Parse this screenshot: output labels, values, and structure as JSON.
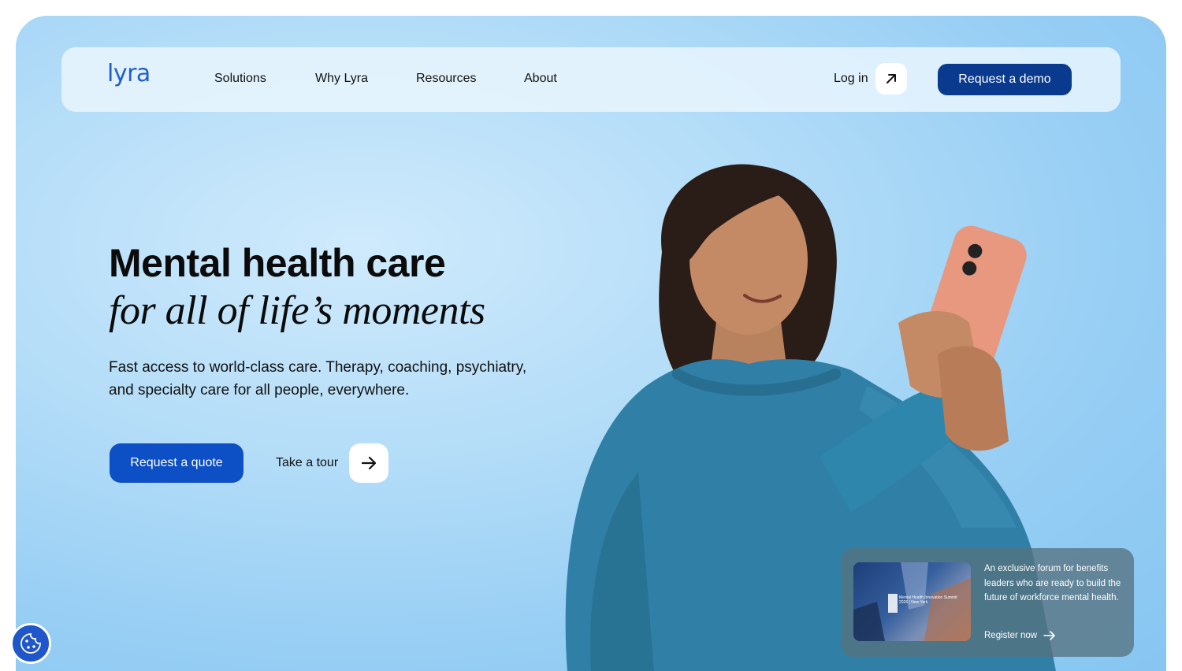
{
  "nav": {
    "logo": "lyra",
    "links": [
      "Solutions",
      "Why Lyra",
      "Resources",
      "About"
    ],
    "login": "Log in",
    "demo": "Request a demo"
  },
  "hero": {
    "title": "Mental health care",
    "title_italic": "for all of life’s moments",
    "subtitle": "Fast access to world-class care. Therapy, coaching, psychiatry, and specialty care for all people, everywhere.",
    "quote_button": "Request a quote",
    "tour_label": "Take a tour"
  },
  "promo": {
    "image_caption": "Mental Health Innovation Summit 2026 | New York",
    "text": "An exclusive forum for benefits leaders who are ready to build the future of workforce mental health.",
    "register": "Register now"
  },
  "colors": {
    "brand_blue": "#0d4fc4",
    "demo_navy": "#0a3a8e",
    "sky": "#9fd4f6",
    "sweater": "#2f7fa6",
    "phone": "#e8987e"
  },
  "icons": {
    "login": "arrow-up-right-icon",
    "tour": "arrow-right-icon",
    "register": "arrow-right-icon",
    "cookie": "cookie-icon"
  }
}
